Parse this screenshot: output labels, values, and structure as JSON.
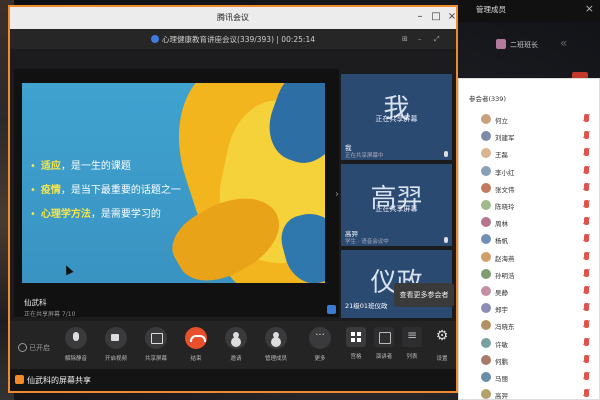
{
  "window": {
    "title": "腾讯会议"
  },
  "meeting": {
    "info": "心理健康教育讲座会议(339/393) | 00:25:14",
    "secure_icon": "shield-icon"
  },
  "slide": {
    "bullets": [
      {
        "highlight": "适应",
        "rest": "，是一生的课题"
      },
      {
        "highlight": "疫情",
        "rest": "，是当下最重要的话题之一"
      },
      {
        "highlight": "心理学方法",
        "rest": "，是需要学习的"
      }
    ],
    "colors": {
      "background": "#3fa2cf",
      "highlight": "#f6e64a",
      "stroke": "#f2b51d"
    }
  },
  "presenter": {
    "name": "仙武科",
    "sub": "正在共享屏幕 7/10"
  },
  "tiles": [
    {
      "big": "我",
      "caption": "正在共享屏幕",
      "name": "我",
      "sub": "正在共享屏幕中"
    },
    {
      "big": "高羿",
      "caption": "正在共享屏幕",
      "name": "高羿",
      "sub": "学生 · 语音会议中"
    },
    {
      "big": "仪政",
      "caption": "",
      "name": "21级01班仪政",
      "sub": ""
    }
  ],
  "tooltip": "查看更多参会者",
  "status": "已开启",
  "controls": [
    {
      "label": "解除静音",
      "icon": "mic-icon"
    },
    {
      "label": "开启视频",
      "icon": "camera-icon"
    },
    {
      "label": "共享屏幕",
      "icon": "share-screen-icon"
    },
    {
      "label": "结束",
      "icon": "phone-hangup-icon"
    },
    {
      "label": "邀请",
      "icon": "invite-icon"
    },
    {
      "label": "管理成员",
      "icon": "members-icon"
    },
    {
      "label": "更多",
      "icon": "more-icon"
    },
    {
      "label": "宫格",
      "icon": "grid-icon"
    },
    {
      "label": "演讲者",
      "icon": "speaker-view-icon"
    },
    {
      "label": "列表",
      "icon": "list-icon"
    },
    {
      "label": "设置",
      "icon": "gear-icon"
    }
  ],
  "sharebar": {
    "text": "仙武科的屏幕共享"
  },
  "chat": {
    "title": "管理成员",
    "top_user": "二班班长",
    "list_header": "参会者(339)",
    "participants": [
      {
        "name": "何立",
        "color": "#c9a27d"
      },
      {
        "name": "刘建军",
        "color": "#7b8ca8"
      },
      {
        "name": "王磊",
        "color": "#d9b48f"
      },
      {
        "name": "李小红",
        "color": "#8aa0b6"
      },
      {
        "name": "张文伟",
        "color": "#c27b5e"
      },
      {
        "name": "陈晓玲",
        "color": "#9fb98a"
      },
      {
        "name": "周林",
        "color": "#b5778f"
      },
      {
        "name": "杨帆",
        "color": "#6f8fb5"
      },
      {
        "name": "赵海燕",
        "color": "#d1a06a"
      },
      {
        "name": "孙明浩",
        "color": "#7e9e6f"
      },
      {
        "name": "吴静",
        "color": "#c58fa3"
      },
      {
        "name": "郑宇",
        "color": "#8c8cb5"
      },
      {
        "name": "冯晓东",
        "color": "#b39063"
      },
      {
        "name": "许敏",
        "color": "#77a1a1"
      },
      {
        "name": "何鹏",
        "color": "#a87a6a"
      },
      {
        "name": "马丽",
        "color": "#6a8fa8"
      },
      {
        "name": "高羿",
        "color": "#b5a16a"
      }
    ]
  }
}
